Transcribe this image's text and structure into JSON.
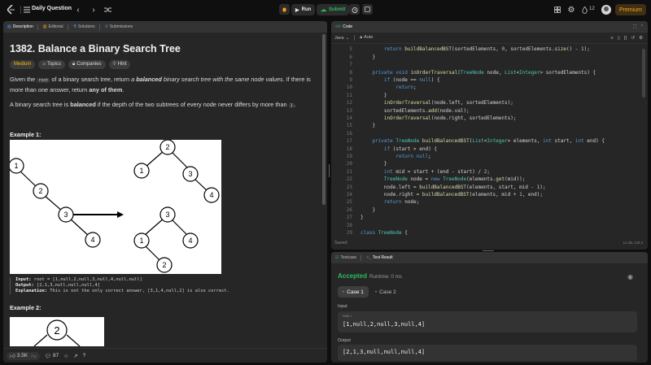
{
  "topbar": {
    "logo": "logo-icon",
    "list_title": "Daily Question",
    "run_label": "Run",
    "submit_label": "Submit",
    "streak_count": "12",
    "premium_label": "Premium"
  },
  "left_tabs": [
    "Description",
    "Editorial",
    "Solutions",
    "Submissions"
  ],
  "problem": {
    "title": "1382. Balance a Binary Search Tree",
    "difficulty": "Medium",
    "tags": [
      "Topics",
      "Companies",
      "Hint"
    ],
    "desc1_a": "Given the ",
    "desc1_code": "root",
    "desc1_b": " of a binary search tree, return ",
    "desc1_em": "a ",
    "desc1_strong": "balanced",
    "desc1_em2": " binary search tree with the same node values",
    "desc1_c": ". If there is more than one answer, return ",
    "desc1_strong2": "any of them",
    "desc1_d": ".",
    "desc2_a": "A binary search tree is ",
    "desc2_strong": "balanced",
    "desc2_b": " if the depth of the two subtrees of every node never differs by more than ",
    "desc2_code": "1",
    "desc2_c": "."
  },
  "example1": {
    "heading": "Example 1:",
    "input_label": "Input:",
    "input_value": "root = [1,null,2,null,3,null,4,null,null]",
    "output_label": "Output:",
    "output_value": "[2,1,3,null,null,null,4]",
    "explanation_label": "Explanation:",
    "explanation_value": "This is not the only correct answer, [3,1,4,null,2] is also correct.",
    "nodes_left": [
      "1",
      "2",
      "3",
      "4"
    ],
    "nodes_right_top": [
      "2",
      "1",
      "3",
      "4"
    ],
    "nodes_right_bottom": [
      "3",
      "1",
      "4",
      "2"
    ]
  },
  "example2": {
    "heading": "Example 2:",
    "root_node": "2"
  },
  "left_footer": {
    "likes": "3.5K",
    "comments": "87"
  },
  "code": {
    "tab_label": "Code",
    "language": "Java",
    "mode": "Auto",
    "status": "Saved",
    "cursor": "Ln 45, Col 2",
    "lines": [
      {
        "n": "4",
        "t": "        inOrderTraversal(root, sortedElements);"
      },
      {
        "n": "5",
        "t": "        return buildBalancedBST(sortedElements, 0, sortedElements.size() - 1);"
      },
      {
        "n": "6",
        "t": "    }"
      },
      {
        "n": "7",
        "t": ""
      },
      {
        "n": "8",
        "t": "    private void inOrderTraversal(TreeNode node, List<Integer> sortedElements) {"
      },
      {
        "n": "9",
        "t": "        if (node == null) {"
      },
      {
        "n": "10",
        "t": "            return;"
      },
      {
        "n": "11",
        "t": "        }"
      },
      {
        "n": "12",
        "t": "        inOrderTraversal(node.left, sortedElements);"
      },
      {
        "n": "13",
        "t": "        sortedElements.add(node.val);"
      },
      {
        "n": "14",
        "t": "        inOrderTraversal(node.right, sortedElements);"
      },
      {
        "n": "15",
        "t": "    }"
      },
      {
        "n": "16",
        "t": ""
      },
      {
        "n": "17",
        "t": "    private TreeNode buildBalancedBST(List<Integer> elements, int start, int end) {"
      },
      {
        "n": "18",
        "t": "        if (start > end) {"
      },
      {
        "n": "19",
        "t": "            return null;"
      },
      {
        "n": "20",
        "t": "        }"
      },
      {
        "n": "21",
        "t": "        int mid = start + (end - start) / 2;"
      },
      {
        "n": "22",
        "t": "        TreeNode node = new TreeNode(elements.get(mid));"
      },
      {
        "n": "23",
        "t": "        node.left = buildBalancedBST(elements, start, mid - 1);"
      },
      {
        "n": "24",
        "t": "        node.right = buildBalancedBST(elements, mid + 1, end);"
      },
      {
        "n": "25",
        "t": "        return node;"
      },
      {
        "n": "26",
        "t": "    }"
      },
      {
        "n": "27",
        "t": "}"
      },
      {
        "n": "28",
        "t": ""
      },
      {
        "n": "29",
        "t": "class TreeNode {"
      }
    ]
  },
  "result": {
    "tab_testcase": "Testcase",
    "tab_result": "Test Result",
    "status": "Accepted",
    "runtime": "Runtime: 0 ms",
    "cases": [
      "Case 1",
      "Case 2"
    ],
    "input_heading": "Input",
    "input_var": "root =",
    "input_value": "[1,null,2,null,3,null,4]",
    "output_heading": "Output",
    "output_value": "[2,1,3,null,null,null,4]"
  },
  "colors": {
    "accepted": "#2cbb5d",
    "medium": "#ffb800",
    "premium": "#ffa116",
    "submit": "#2cbb5d"
  }
}
